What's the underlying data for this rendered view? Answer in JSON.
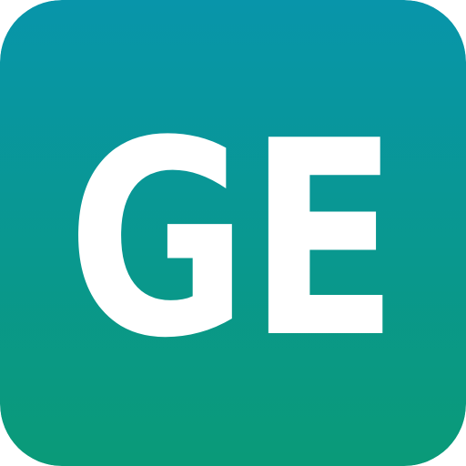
{
  "icon": {
    "name": "app-icon",
    "monogram": "GE",
    "colors": {
      "gradient_top": "#0895AA",
      "gradient_bottom": "#0A9A78",
      "monogram": "#FFFFFF"
    }
  }
}
